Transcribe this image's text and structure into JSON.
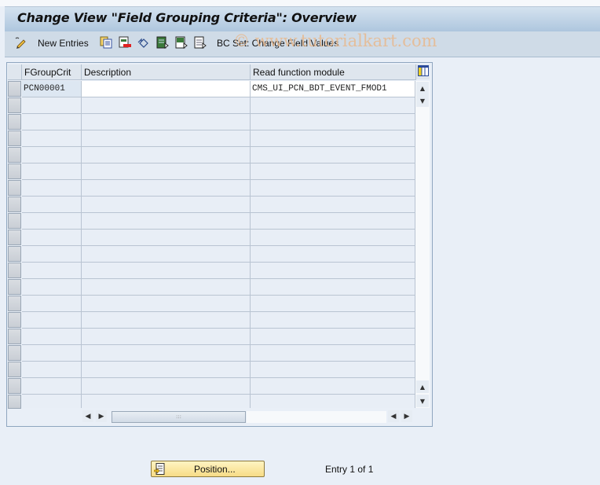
{
  "title": "Change View \"Field Grouping Criteria\": Overview",
  "toolbar": {
    "items": [
      {
        "icon": "edit-glasses-icon"
      },
      {
        "label": "New Entries"
      },
      {
        "icon": "copy-icon"
      },
      {
        "icon": "delete-icon"
      },
      {
        "icon": "undo-icon"
      },
      {
        "icon": "select-all-icon"
      },
      {
        "icon": "select-block-icon"
      },
      {
        "icon": "deselect-all-icon"
      },
      {
        "label": "BC Set: Change Field Values"
      }
    ],
    "new_entries_label": "New Entries",
    "bcset_label": "BC Set: Change Field Values"
  },
  "watermark": "© www.tutorialkart.com",
  "table": {
    "columns": [
      "FGroupCrit",
      "Description",
      "Read function module"
    ],
    "rows": [
      [
        "PCN00001",
        "",
        "CMS_UI_PCN_BDT_EVENT_FMOD1"
      ]
    ],
    "visible_rows": 20
  },
  "footer": {
    "position_button": "Position...",
    "entry_info": "Entry 1 of 1"
  }
}
